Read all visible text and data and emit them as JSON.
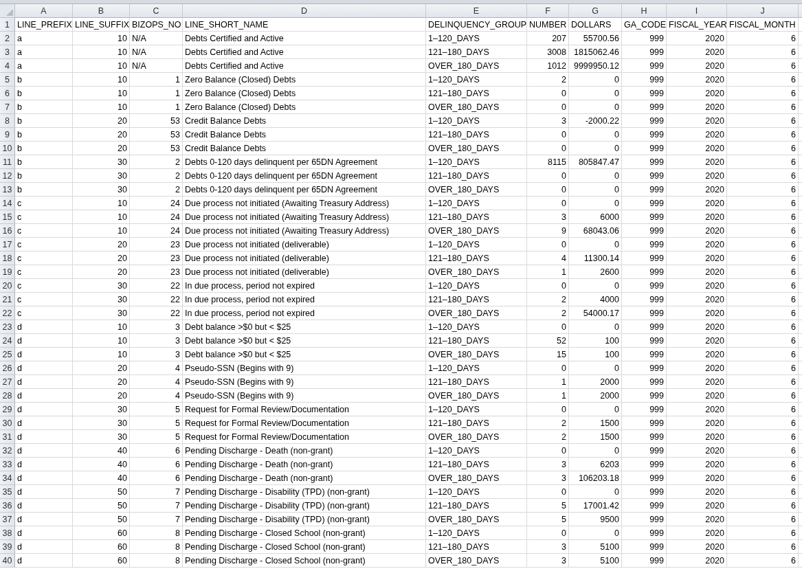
{
  "columns": [
    {
      "letter": "A",
      "kind": "text"
    },
    {
      "letter": "B",
      "kind": "number"
    },
    {
      "letter": "C",
      "kind": "number"
    },
    {
      "letter": "D",
      "kind": "text"
    },
    {
      "letter": "E",
      "kind": "text"
    },
    {
      "letter": "F",
      "kind": "number"
    },
    {
      "letter": "G",
      "kind": "number"
    },
    {
      "letter": "H",
      "kind": "number"
    },
    {
      "letter": "I",
      "kind": "number"
    },
    {
      "letter": "J",
      "kind": "number"
    }
  ],
  "rows": [
    {
      "number": "1",
      "kind": "header",
      "cells": [
        "LINE_PREFIX",
        "LINE_SUFFIX",
        "BIZOPS_NO",
        "LINE_SHORT_NAME",
        "DELINQUENCY_GROUP",
        "NUMBER",
        "DOLLARS",
        "GA_CODE",
        "FISCAL_YEAR",
        "FISCAL_MONTH"
      ]
    },
    {
      "number": "2",
      "kind": "data",
      "cells": [
        "a",
        "10",
        {
          "text": "N/A",
          "kind": "text"
        },
        "Debts Certified and Active",
        "1–120_DAYS",
        "207",
        "55700.56",
        "999",
        "2020",
        "6"
      ]
    },
    {
      "number": "3",
      "kind": "data",
      "cells": [
        "a",
        "10",
        {
          "text": "N/A",
          "kind": "text"
        },
        "Debts Certified and Active",
        "121–180_DAYS",
        "3008",
        "1815062.46",
        "999",
        "2020",
        "6"
      ]
    },
    {
      "number": "4",
      "kind": "data",
      "cells": [
        "a",
        "10",
        {
          "text": "N/A",
          "kind": "text"
        },
        "Debts Certified and Active",
        "OVER_180_DAYS",
        "1012",
        "9999950.12",
        "999",
        "2020",
        "6"
      ]
    },
    {
      "number": "5",
      "kind": "data",
      "cells": [
        "b",
        "10",
        "1",
        "Zero Balance (Closed) Debts",
        "1–120_DAYS",
        "2",
        "0",
        "999",
        "2020",
        "6"
      ]
    },
    {
      "number": "6",
      "kind": "data",
      "cells": [
        "b",
        "10",
        "1",
        "Zero Balance (Closed) Debts",
        "121–180_DAYS",
        "0",
        "0",
        "999",
        "2020",
        "6"
      ]
    },
    {
      "number": "7",
      "kind": "data",
      "cells": [
        "b",
        "10",
        "1",
        "Zero Balance (Closed) Debts",
        "OVER_180_DAYS",
        "0",
        "0",
        "999",
        "2020",
        "6"
      ]
    },
    {
      "number": "8",
      "kind": "data",
      "cells": [
        "b",
        "20",
        "53",
        "Credit Balance Debts",
        "1–120_DAYS",
        "3",
        "-2000.22",
        "999",
        "2020",
        "6"
      ]
    },
    {
      "number": "9",
      "kind": "data",
      "cells": [
        "b",
        "20",
        "53",
        "Credit Balance Debts",
        "121–180_DAYS",
        "0",
        "0",
        "999",
        "2020",
        "6"
      ]
    },
    {
      "number": "10",
      "kind": "data",
      "cells": [
        "b",
        "20",
        "53",
        "Credit Balance Debts",
        "OVER_180_DAYS",
        "0",
        "0",
        "999",
        "2020",
        "6"
      ]
    },
    {
      "number": "11",
      "kind": "data",
      "cells": [
        "b",
        "30",
        "2",
        "Debts 0-120 days delinquent per 65DN Agreement",
        "1–120_DAYS",
        "8115",
        "805847.47",
        "999",
        "2020",
        "6"
      ]
    },
    {
      "number": "12",
      "kind": "data",
      "cells": [
        "b",
        "30",
        "2",
        "Debts 0-120 days delinquent per 65DN Agreement",
        "121–180_DAYS",
        "0",
        "0",
        "999",
        "2020",
        "6"
      ]
    },
    {
      "number": "13",
      "kind": "data",
      "cells": [
        "b",
        "30",
        "2",
        "Debts 0-120 days delinquent per 65DN Agreement",
        "OVER_180_DAYS",
        "0",
        "0",
        "999",
        "2020",
        "6"
      ]
    },
    {
      "number": "14",
      "kind": "data",
      "cells": [
        "c",
        "10",
        "24",
        "Due process not initiated (Awaiting Treasury Address)",
        "1–120_DAYS",
        "0",
        "0",
        "999",
        "2020",
        "6"
      ]
    },
    {
      "number": "15",
      "kind": "data",
      "cells": [
        "c",
        "10",
        "24",
        "Due process not initiated (Awaiting Treasury Address)",
        "121–180_DAYS",
        "3",
        "6000",
        "999",
        "2020",
        "6"
      ]
    },
    {
      "number": "16",
      "kind": "data",
      "cells": [
        "c",
        "10",
        "24",
        "Due process not initiated (Awaiting Treasury Address)",
        "OVER_180_DAYS",
        "9",
        "68043.06",
        "999",
        "2020",
        "6"
      ]
    },
    {
      "number": "17",
      "kind": "data",
      "cells": [
        "c",
        "20",
        "23",
        "Due process not initiated (deliverable)",
        "1–120_DAYS",
        "0",
        "0",
        "999",
        "2020",
        "6"
      ]
    },
    {
      "number": "18",
      "kind": "data",
      "cells": [
        "c",
        "20",
        "23",
        "Due process not initiated (deliverable)",
        "121–180_DAYS",
        "4",
        "11300.14",
        "999",
        "2020",
        "6"
      ]
    },
    {
      "number": "19",
      "kind": "data",
      "cells": [
        "c",
        "20",
        "23",
        "Due process not initiated (deliverable)",
        "OVER_180_DAYS",
        "1",
        "2600",
        "999",
        "2020",
        "6"
      ]
    },
    {
      "number": "20",
      "kind": "data",
      "cells": [
        "c",
        "30",
        "22",
        "In due process, period not expired",
        "1–120_DAYS",
        "0",
        "0",
        "999",
        "2020",
        "6"
      ]
    },
    {
      "number": "21",
      "kind": "data",
      "cells": [
        "c",
        "30",
        "22",
        "In due process, period not expired",
        "121–180_DAYS",
        "2",
        "4000",
        "999",
        "2020",
        "6"
      ]
    },
    {
      "number": "22",
      "kind": "data",
      "cells": [
        "c",
        "30",
        "22",
        "In due process, period not expired",
        "OVER_180_DAYS",
        "2",
        "54000.17",
        "999",
        "2020",
        "6"
      ]
    },
    {
      "number": "23",
      "kind": "data",
      "cells": [
        "d",
        "10",
        "3",
        "Debt balance >$0 but < $25",
        "1–120_DAYS",
        "0",
        "0",
        "999",
        "2020",
        "6"
      ]
    },
    {
      "number": "24",
      "kind": "data",
      "cells": [
        "d",
        "10",
        "3",
        "Debt balance >$0 but < $25",
        "121–180_DAYS",
        "52",
        "100",
        "999",
        "2020",
        "6"
      ]
    },
    {
      "number": "25",
      "kind": "data",
      "cells": [
        "d",
        "10",
        "3",
        "Debt balance >$0 but < $25",
        "OVER_180_DAYS",
        "15",
        "100",
        "999",
        "2020",
        "6"
      ]
    },
    {
      "number": "26",
      "kind": "data",
      "cells": [
        "d",
        "20",
        "4",
        "Pseudo-SSN (Begins with 9)",
        "1–120_DAYS",
        "0",
        "0",
        "999",
        "2020",
        "6"
      ]
    },
    {
      "number": "27",
      "kind": "data",
      "cells": [
        "d",
        "20",
        "4",
        "Pseudo-SSN (Begins with 9)",
        "121–180_DAYS",
        "1",
        "2000",
        "999",
        "2020",
        "6"
      ]
    },
    {
      "number": "28",
      "kind": "data",
      "cells": [
        "d",
        "20",
        "4",
        "Pseudo-SSN (Begins with 9)",
        "OVER_180_DAYS",
        "1",
        "2000",
        "999",
        "2020",
        "6"
      ]
    },
    {
      "number": "29",
      "kind": "data",
      "cells": [
        "d",
        "30",
        "5",
        "Request for Formal Review/Documentation",
        "1–120_DAYS",
        "0",
        "0",
        "999",
        "2020",
        "6"
      ]
    },
    {
      "number": "30",
      "kind": "data",
      "cells": [
        "d",
        "30",
        "5",
        "Request for Formal Review/Documentation",
        "121–180_DAYS",
        "2",
        "1500",
        "999",
        "2020",
        "6"
      ]
    },
    {
      "number": "31",
      "kind": "data",
      "cells": [
        "d",
        "30",
        "5",
        "Request for Formal Review/Documentation",
        "OVER_180_DAYS",
        "2",
        "1500",
        "999",
        "2020",
        "6"
      ]
    },
    {
      "number": "32",
      "kind": "data",
      "cells": [
        "d",
        "40",
        "6",
        "Pending Discharge - Death (non-grant)",
        "1–120_DAYS",
        "0",
        "0",
        "999",
        "2020",
        "6"
      ]
    },
    {
      "number": "33",
      "kind": "data",
      "cells": [
        "d",
        "40",
        "6",
        "Pending Discharge - Death (non-grant)",
        "121–180_DAYS",
        "3",
        "6203",
        "999",
        "2020",
        "6"
      ]
    },
    {
      "number": "34",
      "kind": "data",
      "cells": [
        "d",
        "40",
        "6",
        "Pending Discharge - Death (non-grant)",
        "OVER_180_DAYS",
        "3",
        "106203.18",
        "999",
        "2020",
        "6"
      ]
    },
    {
      "number": "35",
      "kind": "data",
      "cells": [
        "d",
        "50",
        "7",
        "Pending Discharge - Disability (TPD) (non-grant)",
        "1–120_DAYS",
        "0",
        "0",
        "999",
        "2020",
        "6"
      ]
    },
    {
      "number": "36",
      "kind": "data",
      "cells": [
        "d",
        "50",
        "7",
        "Pending Discharge - Disability (TPD) (non-grant)",
        "121–180_DAYS",
        "5",
        "17001.42",
        "999",
        "2020",
        "6"
      ]
    },
    {
      "number": "37",
      "kind": "data",
      "cells": [
        "d",
        "50",
        "7",
        "Pending Discharge - Disability (TPD) (non-grant)",
        "OVER_180_DAYS",
        "5",
        "9500",
        "999",
        "2020",
        "6"
      ]
    },
    {
      "number": "38",
      "kind": "data",
      "cells": [
        "d",
        "60",
        "8",
        "Pending Discharge - Closed School (non-grant)",
        "1–120_DAYS",
        "0",
        "0",
        "999",
        "2020",
        "6"
      ]
    },
    {
      "number": "39",
      "kind": "data",
      "cells": [
        "d",
        "60",
        "8",
        "Pending Discharge - Closed School (non-grant)",
        "121–180_DAYS",
        "3",
        "5100",
        "999",
        "2020",
        "6"
      ]
    },
    {
      "number": "40",
      "kind": "data",
      "cells": [
        "d",
        "60",
        "8",
        "Pending Discharge - Closed School (non-grant)",
        "OVER_180_DAYS",
        "3",
        "5100",
        "999",
        "2020",
        "6"
      ]
    }
  ]
}
